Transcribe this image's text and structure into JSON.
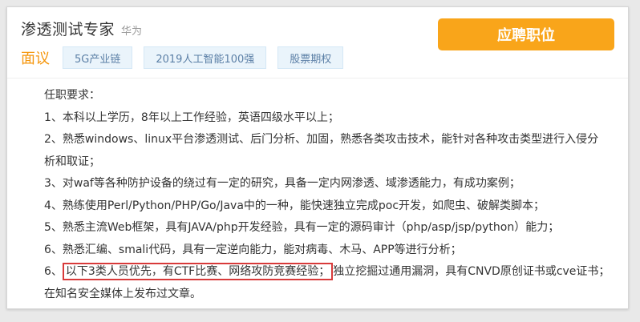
{
  "job": {
    "title": "渗透测试专家",
    "company": "华为",
    "apply_label": "应聘职位"
  },
  "tags": {
    "label": "面议",
    "items": [
      "5G产业链",
      "2019人工智能100强",
      "股票期权"
    ]
  },
  "requirements": {
    "heading": "任职要求：",
    "line1": "1、本科以上学历，8年以上工作经验，英语四级水平以上；",
    "line2a": "2、熟悉windows、linux平台渗透测试、后门分析、加固，熟悉各类攻击技术，能针对各种攻击类型进行入侵分",
    "line2b": "析和取证；",
    "line3": "3、对waf等各种防护设备的绕过有一定的研究，具备一定内网渗透、域渗透能力，有成功案例；",
    "line4": "4、熟练使用Perl/Python/PHP/Go/Java中的一种，能快速独立完成poc开发，如爬虫、破解类脚本；",
    "line5": "5、熟悉主流Web框架，具有JAVA/php开发经验，具有一定的源码审计（php/asp/jsp/python）能力；",
    "line6": "6、熟悉汇编、smali代码，具有一定逆向能力，能对病毒、木马、APP等进行分析；",
    "line7_prefix": "6、",
    "line7_highlight": "以下3类人员优先，有CTF比赛、网络攻防竞赛经验；",
    "line7_rest": "独立挖掘过通用漏洞，具有CNVD原创证书或cve证书；",
    "line8": "在知名安全媒体上发布过文章。"
  },
  "colors": {
    "accent": "#f9a51a",
    "salary": "#f5960c",
    "highlight_border": "#d83a3a"
  }
}
